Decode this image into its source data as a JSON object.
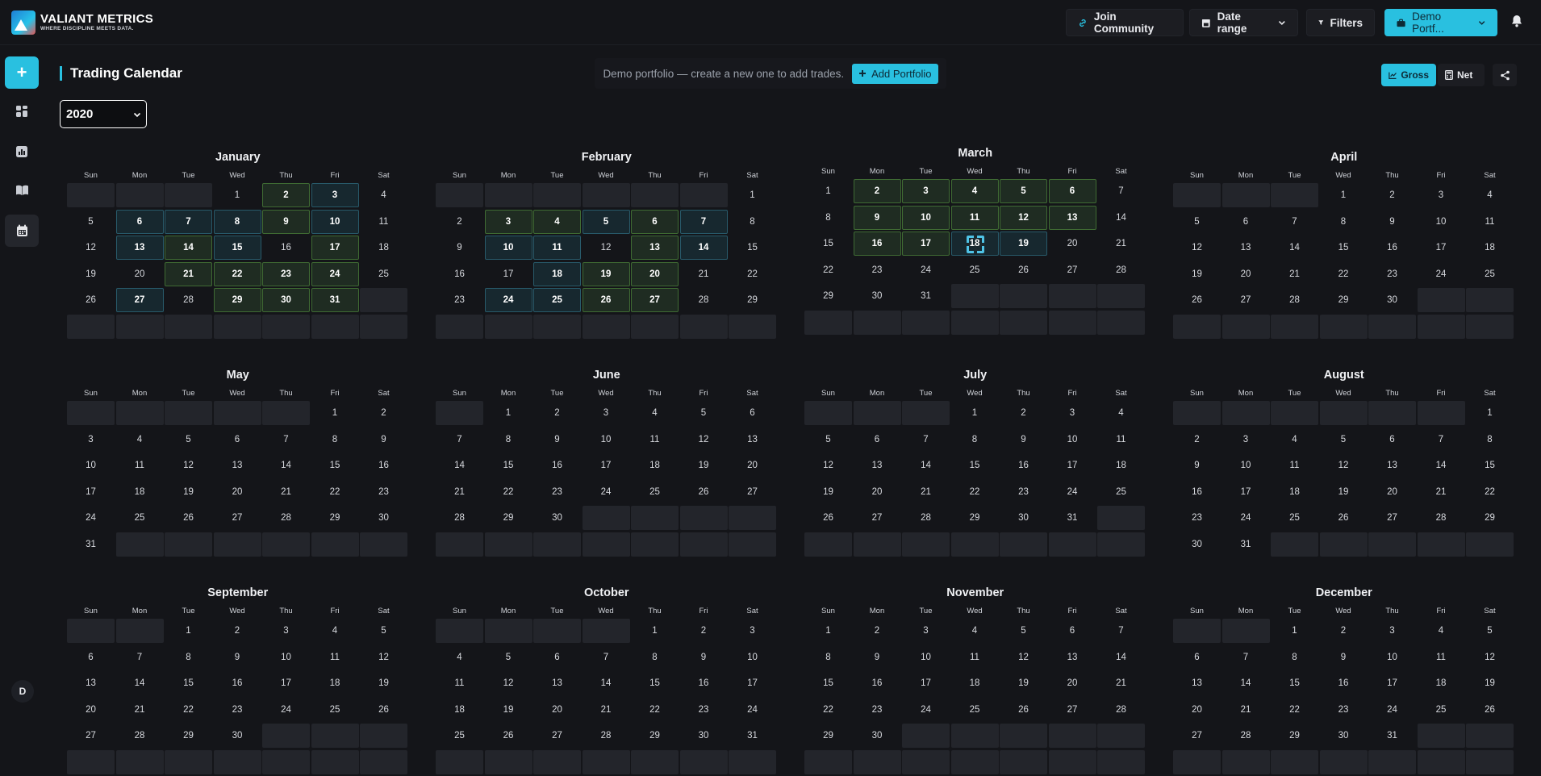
{
  "app": {
    "brand_name": "VALIANT METRICS",
    "brand_tagline": "WHERE DISCIPLINE MEETS DATA."
  },
  "topbar": {
    "join_community": "Join Community",
    "date_range": "Date range",
    "filters": "Filters",
    "portfolio": "Demo Portf..."
  },
  "sidebar": {
    "add_label": "+",
    "avatar_initial": "D"
  },
  "page": {
    "title": "Trading Calendar",
    "notice_text": "Demo portfolio — create a new one to add trades.",
    "add_portfolio": "Add Portfolio",
    "gross_label": "Gross",
    "net_label": "Net",
    "year": "2020"
  },
  "colors": {
    "accent": "#29c0e0",
    "green_day": "#3f6b33",
    "blue_day": "#285a6a",
    "background": "#141519"
  },
  "calendar": {
    "weekdays": [
      "Sun",
      "Mon",
      "Tue",
      "Wed",
      "Thu",
      "Fri",
      "Sat"
    ],
    "months": [
      {
        "name": "January",
        "first_weekday": 3,
        "days": 31,
        "green": [
          2,
          9,
          14,
          17,
          21,
          22,
          23,
          24,
          29,
          30,
          31
        ],
        "blue": [
          3,
          6,
          7,
          8,
          10,
          13,
          15,
          27
        ]
      },
      {
        "name": "February",
        "first_weekday": 6,
        "days": 29,
        "green": [
          3,
          4,
          6,
          13,
          19,
          20,
          26,
          27
        ],
        "blue": [
          5,
          7,
          10,
          11,
          14,
          18,
          24,
          25
        ]
      },
      {
        "name": "March",
        "first_weekday": 0,
        "days": 31,
        "green": [
          2,
          3,
          4,
          5,
          6,
          9,
          10,
          11,
          12,
          13,
          16,
          17
        ],
        "blue": [
          19
        ],
        "cursor": 18
      },
      {
        "name": "April",
        "first_weekday": 3,
        "days": 30,
        "green": [],
        "blue": []
      },
      {
        "name": "May",
        "first_weekday": 5,
        "days": 31,
        "green": [],
        "blue": []
      },
      {
        "name": "June",
        "first_weekday": 1,
        "days": 30,
        "green": [],
        "blue": []
      },
      {
        "name": "July",
        "first_weekday": 3,
        "days": 31,
        "green": [],
        "blue": []
      },
      {
        "name": "August",
        "first_weekday": 6,
        "days": 31,
        "green": [],
        "blue": []
      },
      {
        "name": "September",
        "first_weekday": 2,
        "days": 30,
        "green": [],
        "blue": []
      },
      {
        "name": "October",
        "first_weekday": 4,
        "days": 31,
        "green": [],
        "blue": []
      },
      {
        "name": "November",
        "first_weekday": 0,
        "days": 30,
        "green": [],
        "blue": []
      },
      {
        "name": "December",
        "first_weekday": 2,
        "days": 31,
        "green": [],
        "blue": []
      }
    ]
  }
}
